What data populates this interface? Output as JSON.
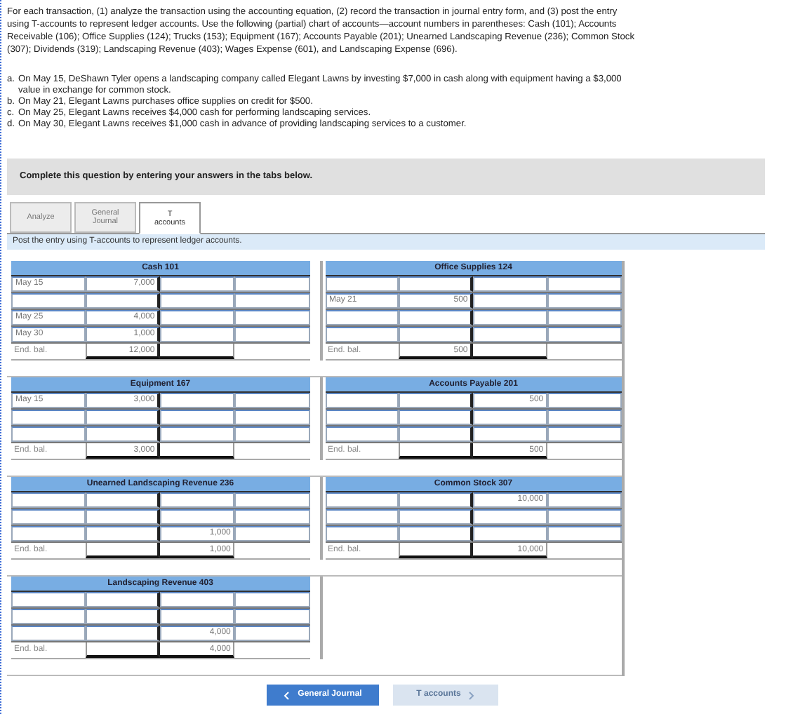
{
  "instructions": "For each transaction, (1) analyze the transaction using the accounting equation, (2) record the transaction in journal entry form, and (3) post the entry using T-accounts to represent ledger accounts. Use the following (partial) chart of accounts—account numbers in parentheses: Cash (101); Accounts Receivable (106); Office Supplies (124); Trucks (153); Equipment (167); Accounts Payable (201); Unearned Landscaping Revenue (236); Common Stock (307); Dividends (319); Landscaping Revenue (403); Wages Expense (601), and Landscaping Expense (696).",
  "transactions": [
    {
      "letter": "a.",
      "text": "On May 15, DeShawn Tyler opens a landscaping company called Elegant Lawns by investing $7,000 in cash along with equipment having a $3,000 value in exchange for common stock."
    },
    {
      "letter": "b.",
      "text": "On May 21, Elegant Lawns purchases office supplies on credit for $500."
    },
    {
      "letter": "c.",
      "text": "On May 25, Elegant Lawns receives $4,000 cash for performing landscaping services."
    },
    {
      "letter": "d.",
      "text": "On May 30, Elegant Lawns receives $1,000 cash in advance of providing landscaping services to a customer."
    }
  ],
  "banner": "Complete this question by entering your answers in the tabs below.",
  "tabs": [
    {
      "label": "Analyze",
      "selected": false
    },
    {
      "label": "General Journal",
      "selected": false
    },
    {
      "label": "T accounts",
      "selected": true
    }
  ],
  "prompt": "Post the entry using T-accounts to represent ledger accounts.",
  "accounts": [
    {
      "title": "Cash 101",
      "rows": [
        {
          "kind": "entry",
          "debit_date": "May 15",
          "debit": "7,000"
        },
        {
          "kind": "entry"
        },
        {
          "kind": "entry",
          "debit_date": "May 25",
          "debit": "4,000"
        },
        {
          "kind": "entry",
          "debit_date": "May 30",
          "debit": "1,000"
        }
      ],
      "end": {
        "label": "End. bal.",
        "debit": "12,000"
      }
    },
    {
      "title": "Office Supplies 124",
      "rows": [
        {
          "kind": "entry"
        },
        {
          "kind": "entry",
          "debit_date": "May 21",
          "debit": "500"
        },
        {
          "kind": "entry"
        },
        {
          "kind": "entry"
        }
      ],
      "end": {
        "label": "End. bal.",
        "debit": "500"
      }
    },
    {
      "title": "Equipment 167",
      "rows": [
        {
          "kind": "entry",
          "debit_date": "May 15",
          "debit": "3,000"
        },
        {
          "kind": "entry"
        },
        {
          "kind": "entry"
        }
      ],
      "end": {
        "label": "End. bal.",
        "debit": "3,000"
      }
    },
    {
      "title": "Accounts Payable 201",
      "rows": [
        {
          "kind": "entry",
          "credit": "500"
        },
        {
          "kind": "entry"
        },
        {
          "kind": "entry"
        }
      ],
      "end": {
        "label": "End. bal.",
        "credit": "500"
      }
    },
    {
      "title": "Unearned Landscaping Revenue 236",
      "rows": [
        {
          "kind": "entry"
        },
        {
          "kind": "entry"
        },
        {
          "kind": "entry",
          "credit": "1,000"
        }
      ],
      "end": {
        "label": "End. bal.",
        "credit": "1,000"
      }
    },
    {
      "title": "Common Stock 307",
      "rows": [
        {
          "kind": "entry",
          "credit": "10,000"
        },
        {
          "kind": "entry"
        },
        {
          "kind": "entry"
        }
      ],
      "end": {
        "label": "End. bal.",
        "credit": "10,000"
      }
    },
    {
      "title": "Landscaping Revenue 403",
      "rows": [
        {
          "kind": "entry"
        },
        {
          "kind": "entry"
        },
        {
          "kind": "entry",
          "credit": "4,000"
        }
      ],
      "end": {
        "label": "End. bal.",
        "credit": "4,000"
      }
    }
  ],
  "nav": {
    "back": {
      "label": "General Journal",
      "disabled": false
    },
    "next": {
      "label": "T accounts",
      "disabled": true
    }
  }
}
